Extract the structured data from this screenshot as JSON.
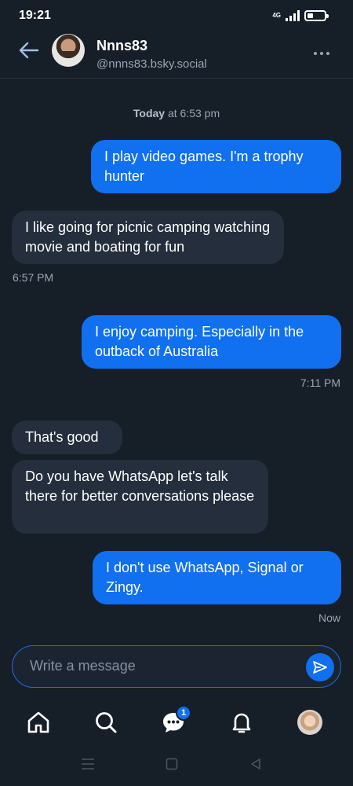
{
  "status_bar": {
    "time": "19:21",
    "network": "4G",
    "battery_level": 0.35
  },
  "header": {
    "back_icon": "arrow-left-icon",
    "name": "Nnns83",
    "handle": "@nnns83.bsky.social",
    "more_icon": "ellipsis-icon"
  },
  "day_separator": {
    "day": "Today",
    "at_time": " at 6:53 pm"
  },
  "messages": [
    {
      "direction": "outgoing",
      "text": "I play video games. I'm a trophy hunter",
      "time": ""
    },
    {
      "direction": "incoming",
      "text": "I like going for picnic camping watching movie and boating for fun",
      "time": "6:57 PM"
    },
    {
      "direction": "outgoing",
      "text": "I enjoy camping. Especially in the outback of Australia",
      "time": "7:11 PM"
    },
    {
      "direction": "incoming",
      "text": "That's good",
      "time": ""
    },
    {
      "direction": "incoming",
      "text": "Do you have WhatsApp let's talk there for better conversations please",
      "time": ""
    },
    {
      "direction": "outgoing",
      "text": "I don't use WhatsApp, Signal or Zingy.",
      "time": "Now"
    }
  ],
  "composer": {
    "placeholder": "Write a message",
    "send_icon": "send-icon"
  },
  "bottom_nav": {
    "items": [
      {
        "name": "home",
        "icon": "home-icon"
      },
      {
        "name": "search",
        "icon": "search-icon"
      },
      {
        "name": "chat",
        "icon": "chat-icon",
        "badge": "1"
      },
      {
        "name": "notifications",
        "icon": "bell-icon"
      },
      {
        "name": "profile",
        "icon": "avatar"
      }
    ]
  },
  "colors": {
    "background": "#161e27",
    "outgoing_bubble": "#1070f0",
    "incoming_bubble": "#242e3c",
    "muted_text": "#9aa6b5"
  }
}
